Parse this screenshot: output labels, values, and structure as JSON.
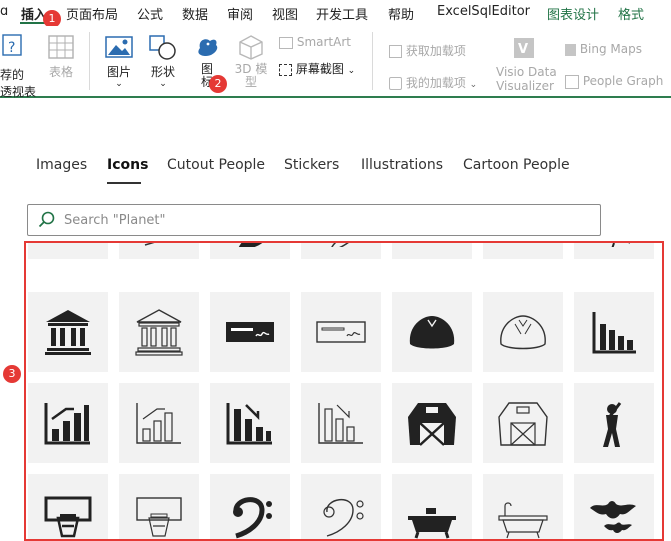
{
  "menubar": {
    "items": [
      {
        "label": "插入",
        "active": true
      },
      {
        "label": "页面布局"
      },
      {
        "label": "公式"
      },
      {
        "label": "数据"
      },
      {
        "label": "审阅"
      },
      {
        "label": "视图"
      },
      {
        "label": "开发工具"
      },
      {
        "label": "帮助"
      },
      {
        "label": "ExcelSqlEditor"
      },
      {
        "label": "图表设计",
        "green": true
      },
      {
        "label": "格式",
        "green": true
      }
    ]
  },
  "ribbon": {
    "recommended_pivot": {
      "line1": "荐的",
      "line2": "透视表"
    },
    "table": "表格",
    "pictures": "图片",
    "shapes": "形状",
    "icons": {
      "line1": "图",
      "line2": "标"
    },
    "models_3d": {
      "line1": "3D 模",
      "line2": "型"
    },
    "smartart": "SmartArt",
    "screenshot": "屏幕截图",
    "get_addins": "获取加载项",
    "my_addins": "我的加载项",
    "visio": {
      "line1": "Visio Data",
      "line2": "Visualizer"
    },
    "bing_maps": "Bing Maps",
    "people_graph": "People Graph"
  },
  "badges": [
    "1",
    "2",
    "3"
  ],
  "tabs": [
    {
      "label": "Images"
    },
    {
      "label": "Icons",
      "selected": true
    },
    {
      "label": "Cutout People"
    },
    {
      "label": "Stickers"
    },
    {
      "label": "Illustrations"
    },
    {
      "label": "Cartoon People"
    }
  ],
  "search": {
    "placeholder": "Search \"Planet\"",
    "value": ""
  },
  "gallery": {
    "rows": [
      [
        "partial-icon",
        "partial-icon",
        "partial-icon",
        "partial-icon",
        "partial-icon",
        "partial-icon",
        "partial-icon"
      ],
      [
        "bank-icon-filled",
        "bank-icon-outline",
        "check-icon-filled",
        "check-icon-outline",
        "bun-icon-filled",
        "bun-icon-outline",
        "bar-chart-icon-filled"
      ],
      [
        "bar-chart-up-icon-filled",
        "bar-chart-up-icon-outline",
        "bar-chart-down-icon-filled",
        "bar-chart-down-icon-outline",
        "barn-icon-filled",
        "barn-icon-outline",
        "baseball-player-icon"
      ],
      [
        "basketball-hoop-icon-filled",
        "basketball-hoop-icon-outline",
        "bass-clef-icon-filled",
        "bass-clef-icon-outline",
        "bathtub-icon-filled",
        "bathtub-icon-outline",
        "bats-icon"
      ]
    ]
  },
  "colors": {
    "accent": "#217346",
    "highlight": "#e53935",
    "tile_bg": "#f2f2f2"
  }
}
